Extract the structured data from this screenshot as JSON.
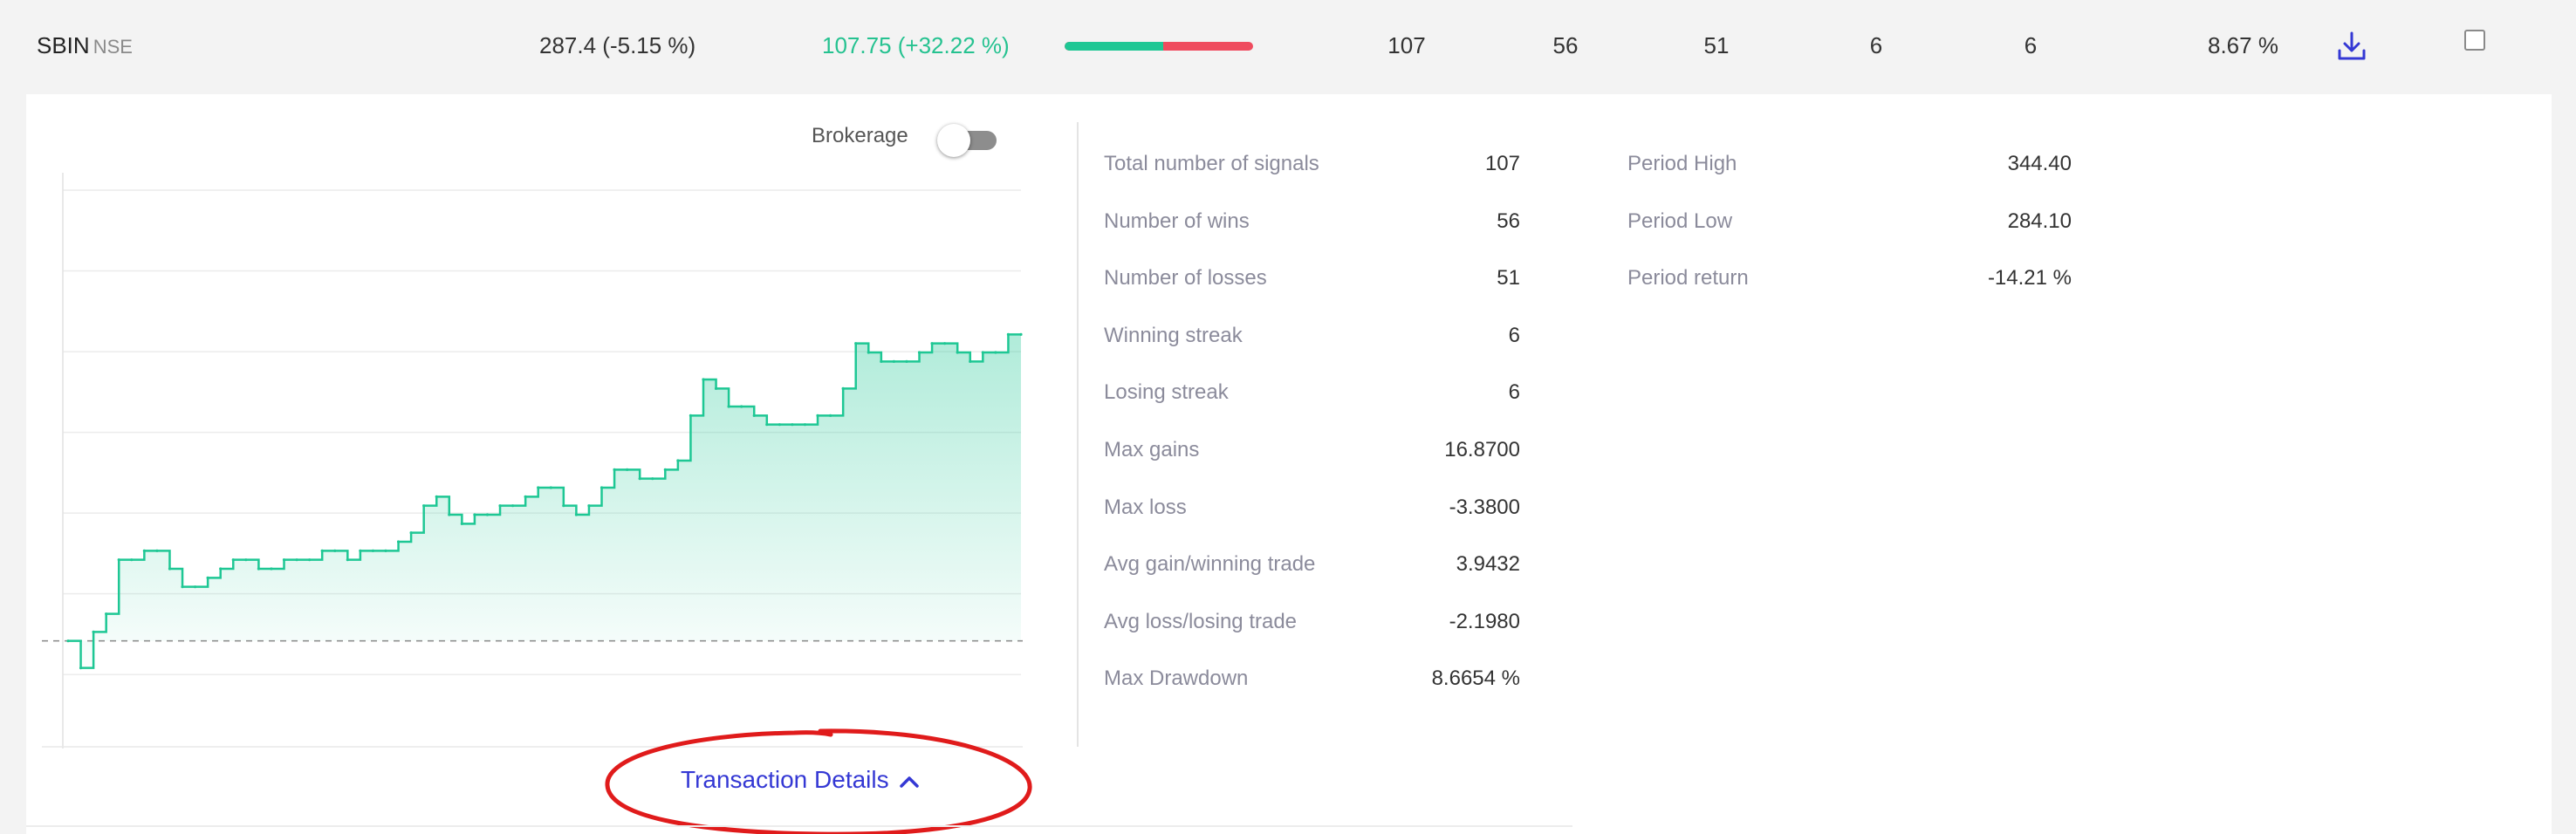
{
  "summary": {
    "symbol": "SBIN",
    "exchange": "NSE",
    "price": "287.4 (-5.15 %)",
    "strategy_return": "107.75 (+32.22 %)",
    "win_ratio_fraction": 0.5234,
    "total_signals": "107",
    "wins": "56",
    "losses": "51",
    "winning_streak": "6",
    "losing_streak": "6",
    "max_drawdown": "8.67 %"
  },
  "brokerage": {
    "label": "Brokerage",
    "enabled": false
  },
  "stats": [
    {
      "label": "Total number of signals",
      "value": "107"
    },
    {
      "label": "Number of wins",
      "value": "56"
    },
    {
      "label": "Number of losses",
      "value": "51"
    },
    {
      "label": "Winning streak",
      "value": "6"
    },
    {
      "label": "Losing streak",
      "value": "6"
    },
    {
      "label": "Max gains",
      "value": "16.8700"
    },
    {
      "label": "Max loss",
      "value": "-3.3800"
    },
    {
      "label": "Avg gain/winning trade",
      "value": "3.9432"
    },
    {
      "label": "Avg loss/losing trade",
      "value": "-2.1980"
    },
    {
      "label": "Max Drawdown",
      "value": "8.6654 %"
    }
  ],
  "period": [
    {
      "label": "Period High",
      "value": "344.40"
    },
    {
      "label": "Period Low",
      "value": "284.10"
    },
    {
      "label": "Period return",
      "value": "-14.21 %"
    }
  ],
  "transaction_details": {
    "label": "Transaction Details",
    "expanded": true
  },
  "colors": {
    "accent_green": "#1ec794",
    "loss_red": "#ef4b5e",
    "link_blue": "#3438d4",
    "annotation_red": "#e01b1b"
  },
  "icons": {
    "download": "download-icon",
    "chevron": "chevron-up-icon"
  },
  "chart_data": {
    "type": "area",
    "title": "",
    "xlabel": "",
    "ylabel": "",
    "grid": true,
    "series": [
      {
        "values": [
          0,
          -3,
          1,
          3,
          9,
          9,
          10,
          10,
          8,
          6,
          6,
          7,
          8,
          9,
          9,
          8,
          8,
          9,
          9,
          9,
          10,
          10,
          9,
          10,
          10,
          10,
          11,
          12,
          15,
          16,
          14,
          13,
          14,
          14,
          15,
          15,
          16,
          17,
          17,
          15,
          14,
          15,
          17,
          19,
          19,
          18,
          18,
          19,
          20,
          25,
          29,
          28,
          26,
          26,
          25,
          24,
          24,
          24,
          24,
          25,
          25,
          28,
          33,
          32,
          31,
          31,
          31,
          32,
          33,
          33,
          32,
          31,
          32,
          32,
          34,
          34
        ]
      }
    ],
    "baseline": 0
  }
}
